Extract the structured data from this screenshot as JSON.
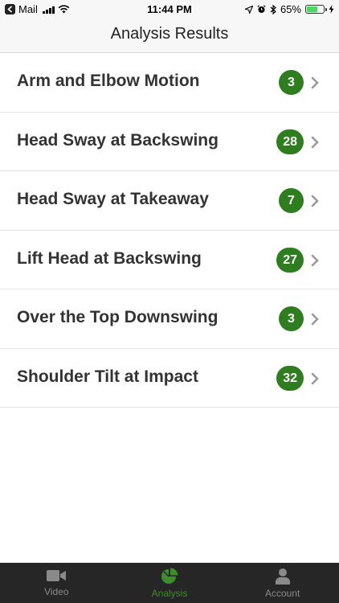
{
  "status_bar": {
    "back_app": "Mail",
    "time": "11:44 PM",
    "battery_percent": "65%",
    "battery_level": 0.65
  },
  "nav": {
    "title": "Analysis Results"
  },
  "results": [
    {
      "label": "Arm and Elbow Motion",
      "count": "3"
    },
    {
      "label": "Head Sway at Backswing",
      "count": "28"
    },
    {
      "label": "Head Sway at Takeaway",
      "count": "7"
    },
    {
      "label": "Lift Head at Backswing",
      "count": "27"
    },
    {
      "label": "Over the Top Downswing",
      "count": "3"
    },
    {
      "label": "Shoulder Tilt at Impact",
      "count": "32"
    }
  ],
  "tabs": [
    {
      "label": "Video",
      "icon": "video-camera-icon",
      "active": false
    },
    {
      "label": "Analysis",
      "icon": "pie-chart-icon",
      "active": true
    },
    {
      "label": "Account",
      "icon": "person-icon",
      "active": false
    }
  ],
  "colors": {
    "accent": "#3b8e2a",
    "badge": "#2e7d1e",
    "tab_bar": "#262626",
    "tab_inactive": "#8a8a8a"
  }
}
